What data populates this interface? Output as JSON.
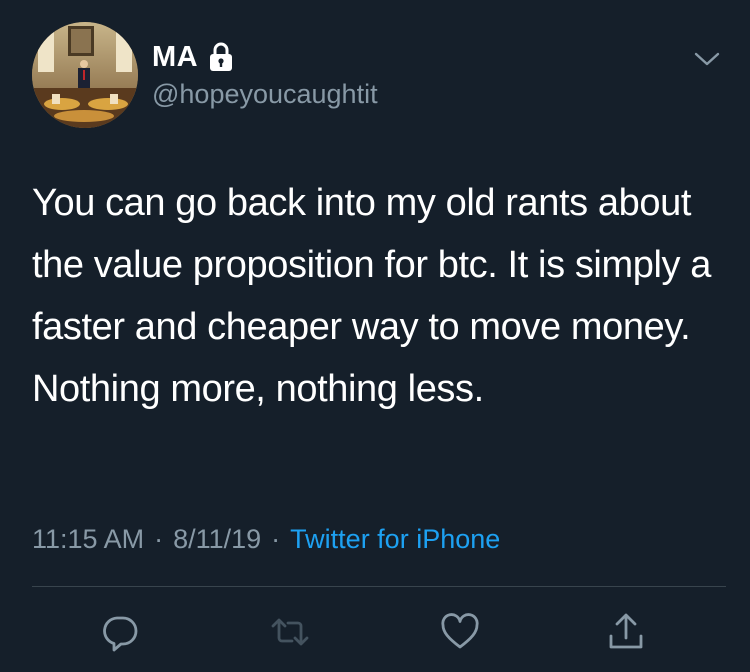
{
  "user": {
    "display_name": "MA",
    "handle": "@hopeyoucaughtit",
    "protected": true
  },
  "tweet": {
    "text": "You can go back into my old rants about the value proposition for btc. It is simply a faster and cheaper way to move money. Nothing more, nothing less.",
    "time": "11:15 AM",
    "date": "8/11/19",
    "separator": "·",
    "source": "Twitter for iPhone"
  },
  "icons": {
    "lock": "lock-icon",
    "caret": "chevron-down-icon",
    "reply": "reply-icon",
    "retweet": "retweet-icon",
    "like": "heart-icon",
    "share": "share-icon"
  },
  "colors": {
    "background": "#151f2a",
    "text": "#ffffff",
    "muted": "#8899a6",
    "link": "#1da1f2",
    "divider": "#38444d"
  }
}
